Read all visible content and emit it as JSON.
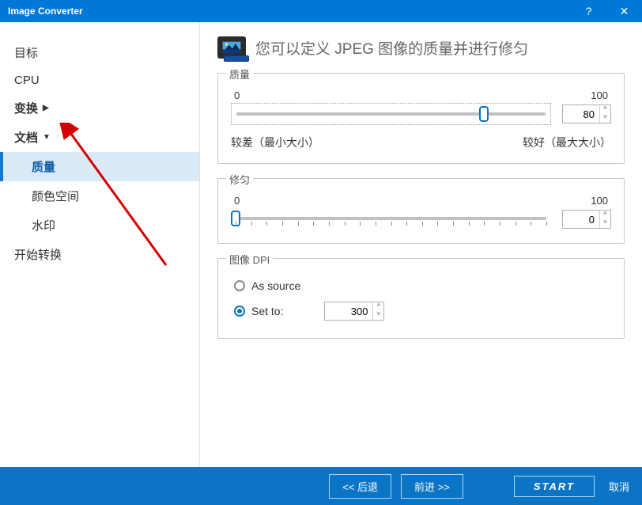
{
  "title": "Image Converter",
  "sidebar": {
    "target": "目标",
    "cpu": "CPU",
    "transform": "变换",
    "document": "文档",
    "quality": "质量",
    "color_space": "颜色空间",
    "watermark": "水印",
    "start_convert": "开始转换"
  },
  "main": {
    "title": "您可以定义 JPEG 图像的质量并进行修匀",
    "quality": {
      "title": "质量",
      "min": "0",
      "max": "100",
      "value": "80",
      "low_label": "较差（最小大小）",
      "high_label": "较好（最大大小）"
    },
    "smooth": {
      "title": "修匀",
      "min": "0",
      "max": "100",
      "value": "0"
    },
    "dpi": {
      "title": "图像 DPI",
      "as_source": "As source",
      "set_to": "Set to:",
      "value": "300"
    }
  },
  "footer": {
    "back": "<<  后退",
    "next": "前进  >>",
    "start": "START",
    "cancel": "取消"
  }
}
